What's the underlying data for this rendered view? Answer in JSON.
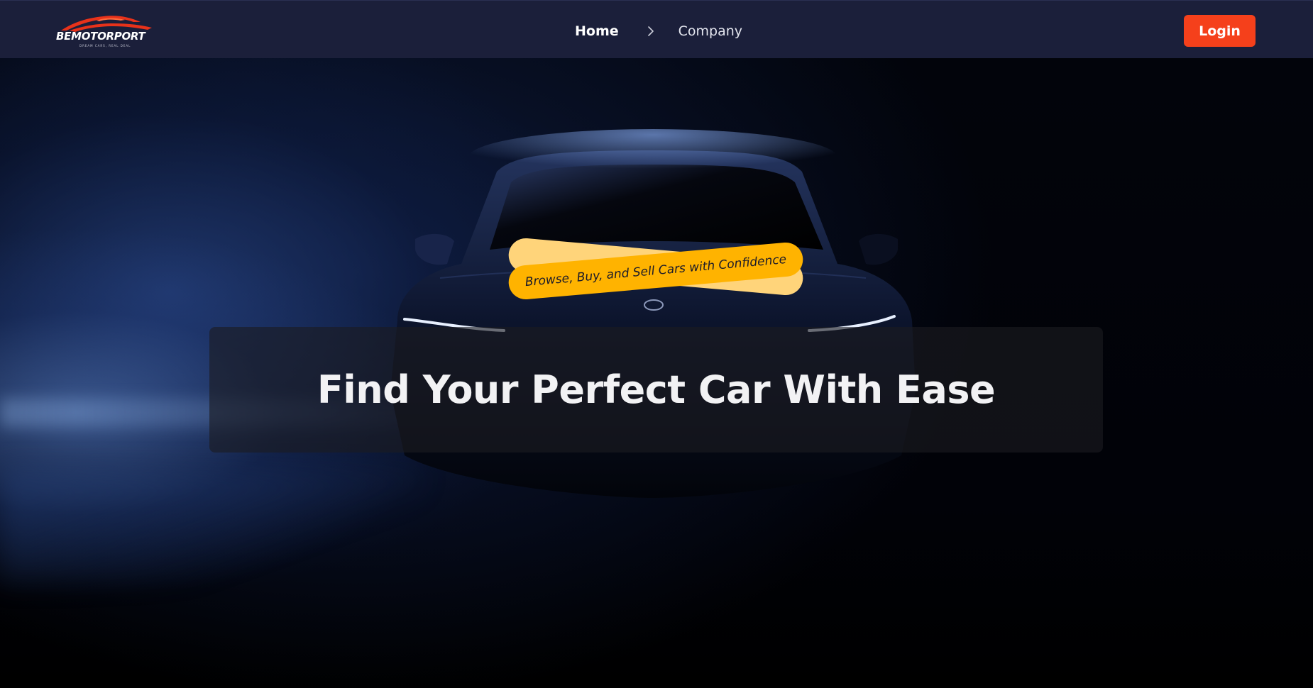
{
  "header": {
    "logo": {
      "name": "BEMOTORPORT",
      "tagline": "DREAM CARS, REAL DEAL",
      "accent_color": "#e8321a"
    },
    "nav": {
      "items": [
        {
          "label": "Home",
          "active": true
        },
        {
          "label": "Company",
          "active": false
        }
      ],
      "separator_icon": "chevron-right-icon"
    },
    "login_label": "Login",
    "login_color": "#f5401b",
    "background_color": "#1b1f3a"
  },
  "hero": {
    "tagline": "Browse, Buy, and Sell Cars with Confidence",
    "headline": "Find Your Perfect Car With Ease",
    "ribbon_color": "#ffb300",
    "background_image": "dark sports sedan front view with blue lighting"
  }
}
